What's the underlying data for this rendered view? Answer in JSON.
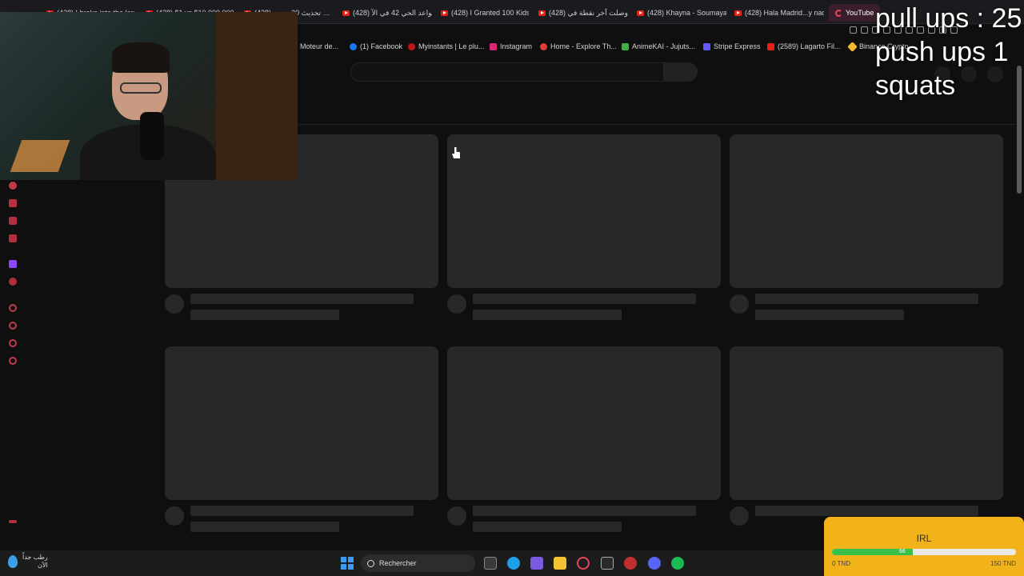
{
  "browser": {
    "tabs": [
      {
        "label": "(428) I broke into the larg…"
      },
      {
        "label": "(428) $1 vs $10,000,000…"
      },
      {
        "label": "(428) تحديث 30 تحدي …"
      },
      {
        "label": "(428) قواعد الحي 42 في الآ"
      },
      {
        "label": "(428) I Granted 100 Kids"
      },
      {
        "label": "(428) وصلت آخر نقطة في"
      },
      {
        "label": "(428) Khayna - Soumaya"
      },
      {
        "label": "(428) Hala Madrid...y nad"
      }
    ],
    "active_tab": {
      "label": "YouTube"
    },
    "bookmarks": [
      {
        "label": "Moteur de...",
        "color": "#3a78d8"
      },
      {
        "label": "(1) Facebook",
        "color": "#1877f2"
      },
      {
        "label": "Myinstants | Le plu...",
        "color": "#c0141a"
      },
      {
        "label": "Instagram",
        "color": "#d62976"
      },
      {
        "label": "Home - Explore Th...",
        "color": "#e03a3a"
      },
      {
        "label": "AnimeKAI - Jujuts...",
        "color": "#3cb043"
      },
      {
        "label": "Stripe Express",
        "color": "#635bff"
      },
      {
        "label": "(2589) Lagarto Fil...",
        "color": "#e62117"
      },
      {
        "label": "Binance Crypto",
        "color": "#f3ba2f"
      }
    ]
  },
  "overlay": {
    "line1": "pull ups : 25",
    "line2": "push ups 1",
    "line3": "squats"
  },
  "goal": {
    "title": "IRL",
    "current": "66",
    "min": "0 TND",
    "max": "150 TND",
    "progress_fraction": 0.44,
    "accent": "#f2b21a",
    "fill_color": "#38c24b"
  },
  "taskbar": {
    "weather_line1": "رطب جداً",
    "weather_line2": "الآن",
    "search_label": "Rechercher"
  }
}
